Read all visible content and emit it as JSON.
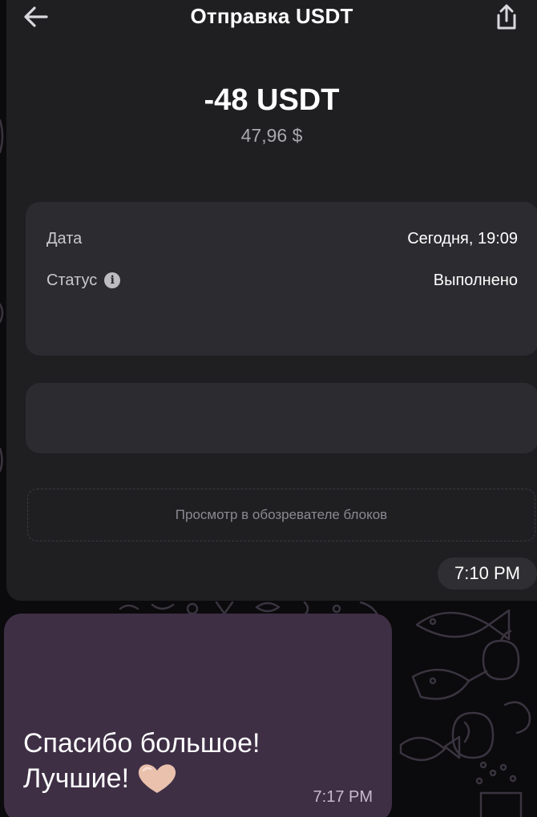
{
  "screenshot": {
    "title": "Отправка USDT",
    "amount": "-48 USDT",
    "amount_fiat": "47,96 $",
    "details": [
      {
        "label": "Дата",
        "value": "Сегодня, 19:09"
      },
      {
        "label": "Статус",
        "value": "Выполнено"
      }
    ],
    "explorer_button": "Просмотр в обозревателе блоков",
    "icons": {
      "back": "back-arrow-icon",
      "share": "share-icon",
      "info": "info-icon"
    }
  },
  "chat": {
    "image_time": "7:10 PM",
    "message": {
      "line1": "Спасибо большое!",
      "line2": "Лучшие!",
      "emoji": "heart-icon",
      "time": "7:17 PM"
    }
  },
  "colors": {
    "background": "#0b0a0c",
    "screenshot_bg": "#1f1e21",
    "card_bg": "#2c2b2f",
    "outgoing_bubble": "#3e2f45",
    "heart": "#e9c1ad"
  }
}
